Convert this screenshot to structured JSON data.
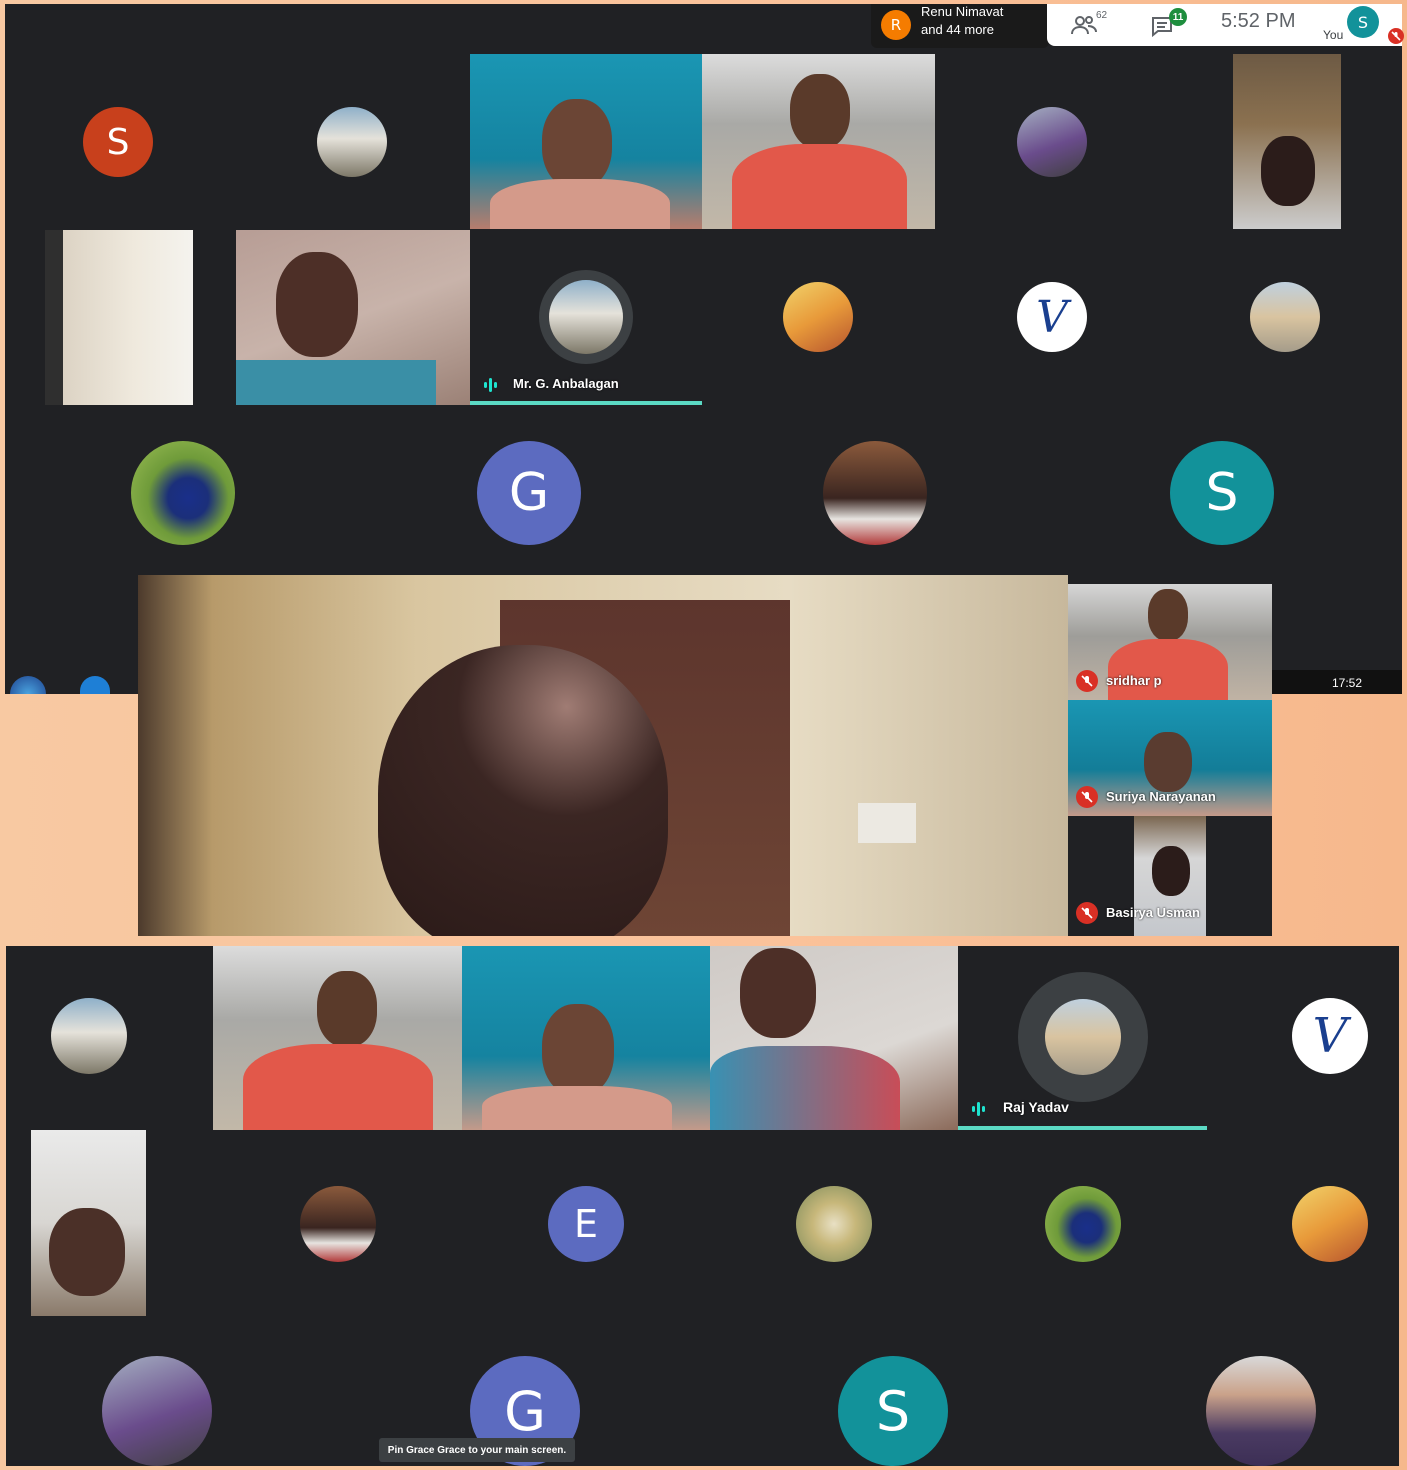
{
  "header": {
    "presenter_initial": "R",
    "presenter_line1": "Renu Nimavat",
    "presenter_line2": "and 44 more",
    "people_count": "62",
    "chat_count": "11",
    "time": "5:52 PM",
    "self_label": "You",
    "self_initial": "S"
  },
  "shot1": {
    "letters": {
      "s1": "S",
      "g1": "G",
      "s2": "S"
    },
    "speaker_name": "Mr. G. Anbalagan"
  },
  "shot2": {
    "taskbar_clock": "17:52",
    "side_tiles": [
      {
        "name": "sridhar p"
      },
      {
        "name": "Suriya Narayanan"
      },
      {
        "name": "Basirya Usman"
      }
    ]
  },
  "shot3": {
    "speaker_name": "Raj Yadav",
    "letters": {
      "e1": "E",
      "g2": "G",
      "s3": "S"
    },
    "tooltip": "Pin Grace Grace to your main screen."
  },
  "colors": {
    "panel": "#202124",
    "avatar_red": "#c8401c",
    "avatar_blue": "#5c6bc0",
    "avatar_teal": "#12929a",
    "speaking_bar": "#5bd9c4",
    "mute_red": "#d93025"
  }
}
